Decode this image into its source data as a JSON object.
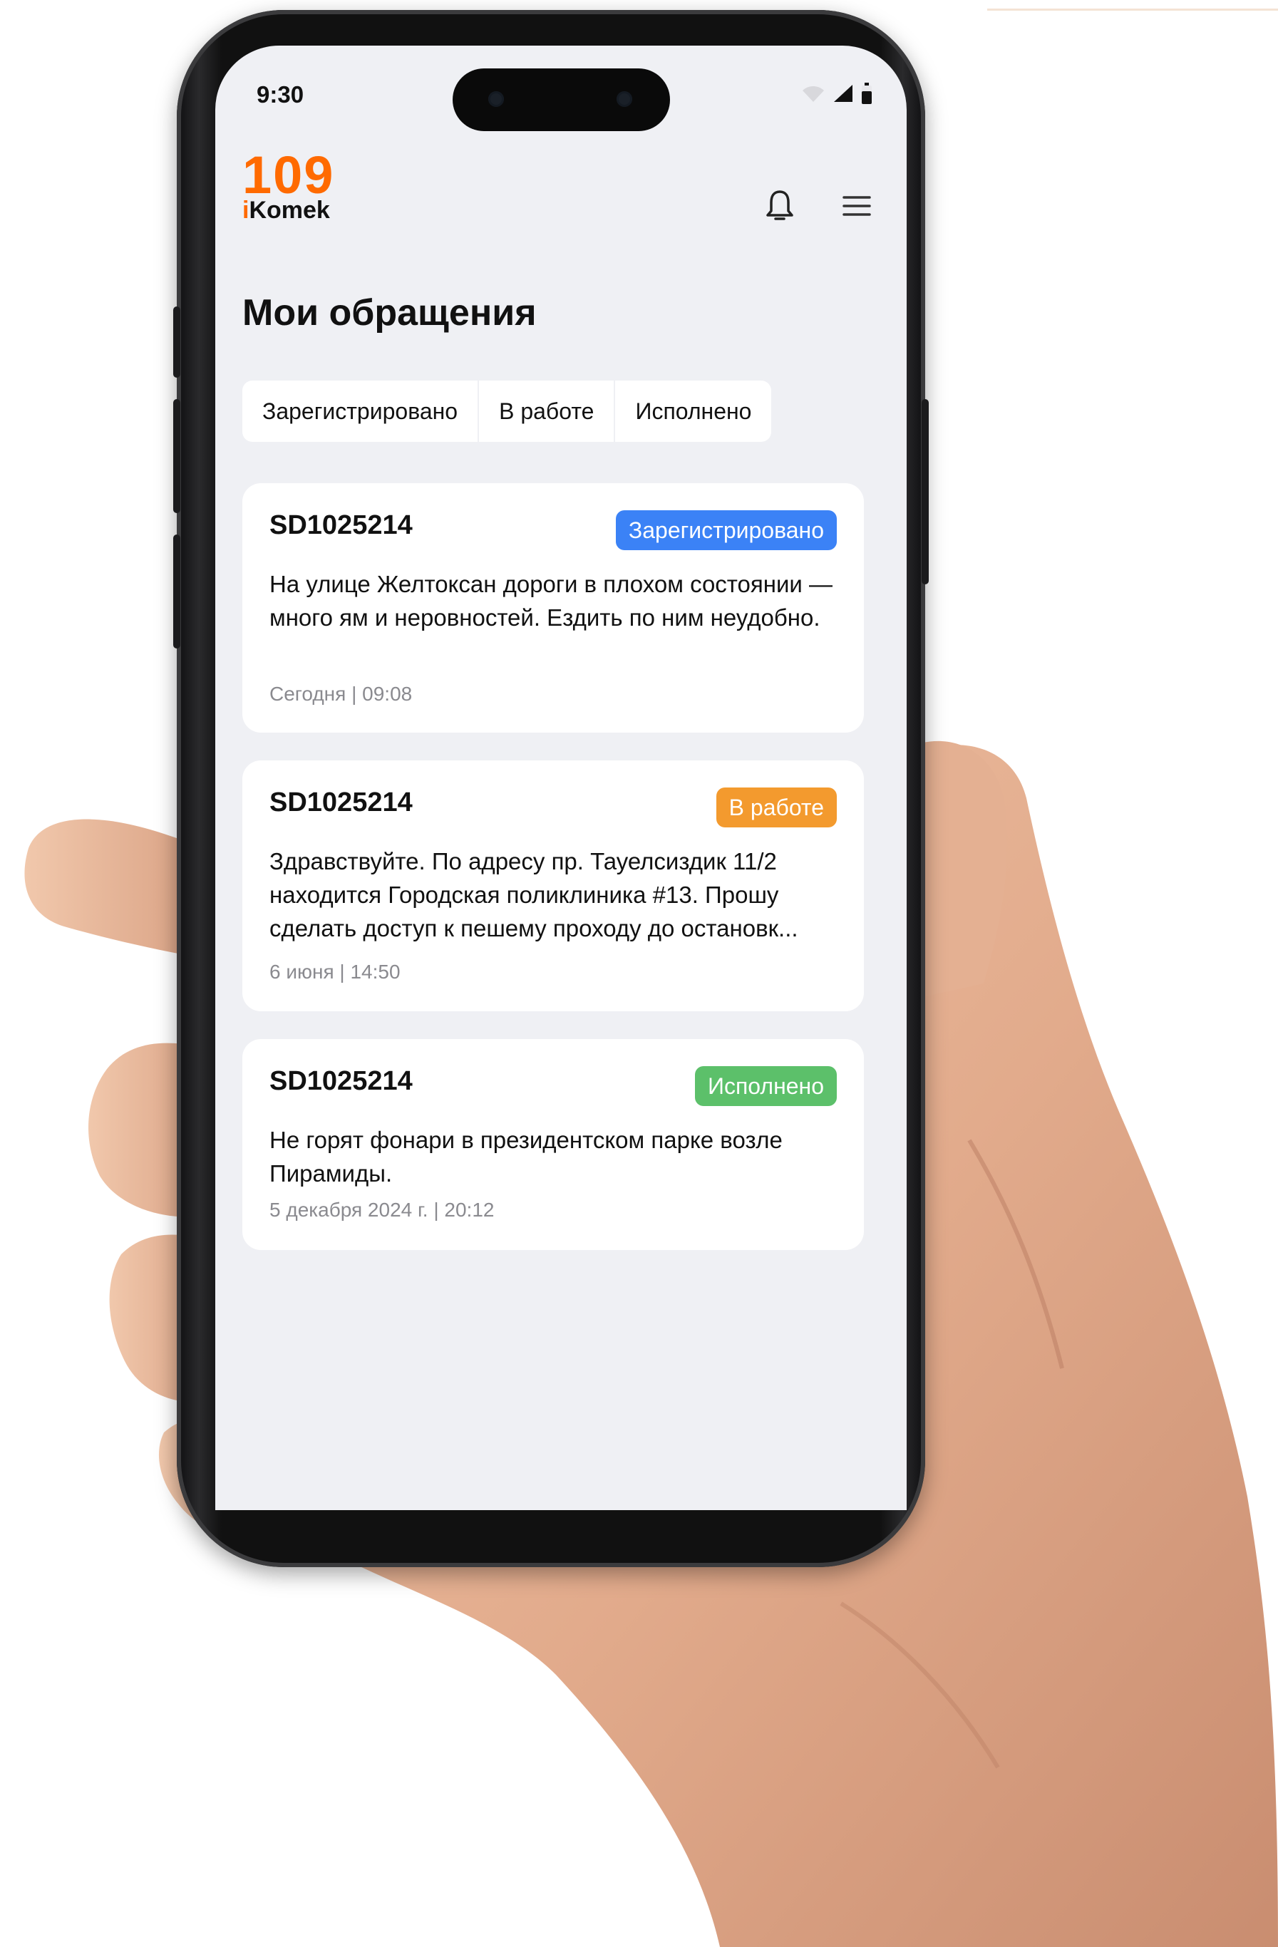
{
  "status_bar": {
    "time": "9:30"
  },
  "header": {
    "logo_number": "109",
    "logo_word_prefix": "i",
    "logo_word_rest": "Komek",
    "icons": [
      "bell-icon",
      "menu-icon"
    ]
  },
  "page": {
    "title": "Мои обращения"
  },
  "tabs": [
    {
      "label": "Зарегистрировано"
    },
    {
      "label": "В работе"
    },
    {
      "label": "Исполнено"
    }
  ],
  "colors": {
    "brand": "#ff6a00",
    "registered": "#3b82f6",
    "in_progress": "#f39a2e",
    "done": "#5cc06a"
  },
  "requests": [
    {
      "id": "SD1025214",
      "status": "Зарегистрировано",
      "text": "На улице Желтоксан дороги в плохом состоянии — много ям и неровностей. Ездить по ним неудобно.",
      "date": "Сегодня | 09:08"
    },
    {
      "id": "SD1025214",
      "status": "В работе",
      "text": "Здравствуйте. По адресу пр. Тауелсиздик 11/2 находится Городская поликлиника #13. Прошу сделать доступ к пешему проходу до остановк...",
      "date": "6 июня | 14:50"
    },
    {
      "id": "SD1025214",
      "status": "Исполнено",
      "text": "Не горят фонари в президентском парке возле Пирамиды.",
      "date": "5 декабря 2024 г. | 20:12"
    }
  ]
}
